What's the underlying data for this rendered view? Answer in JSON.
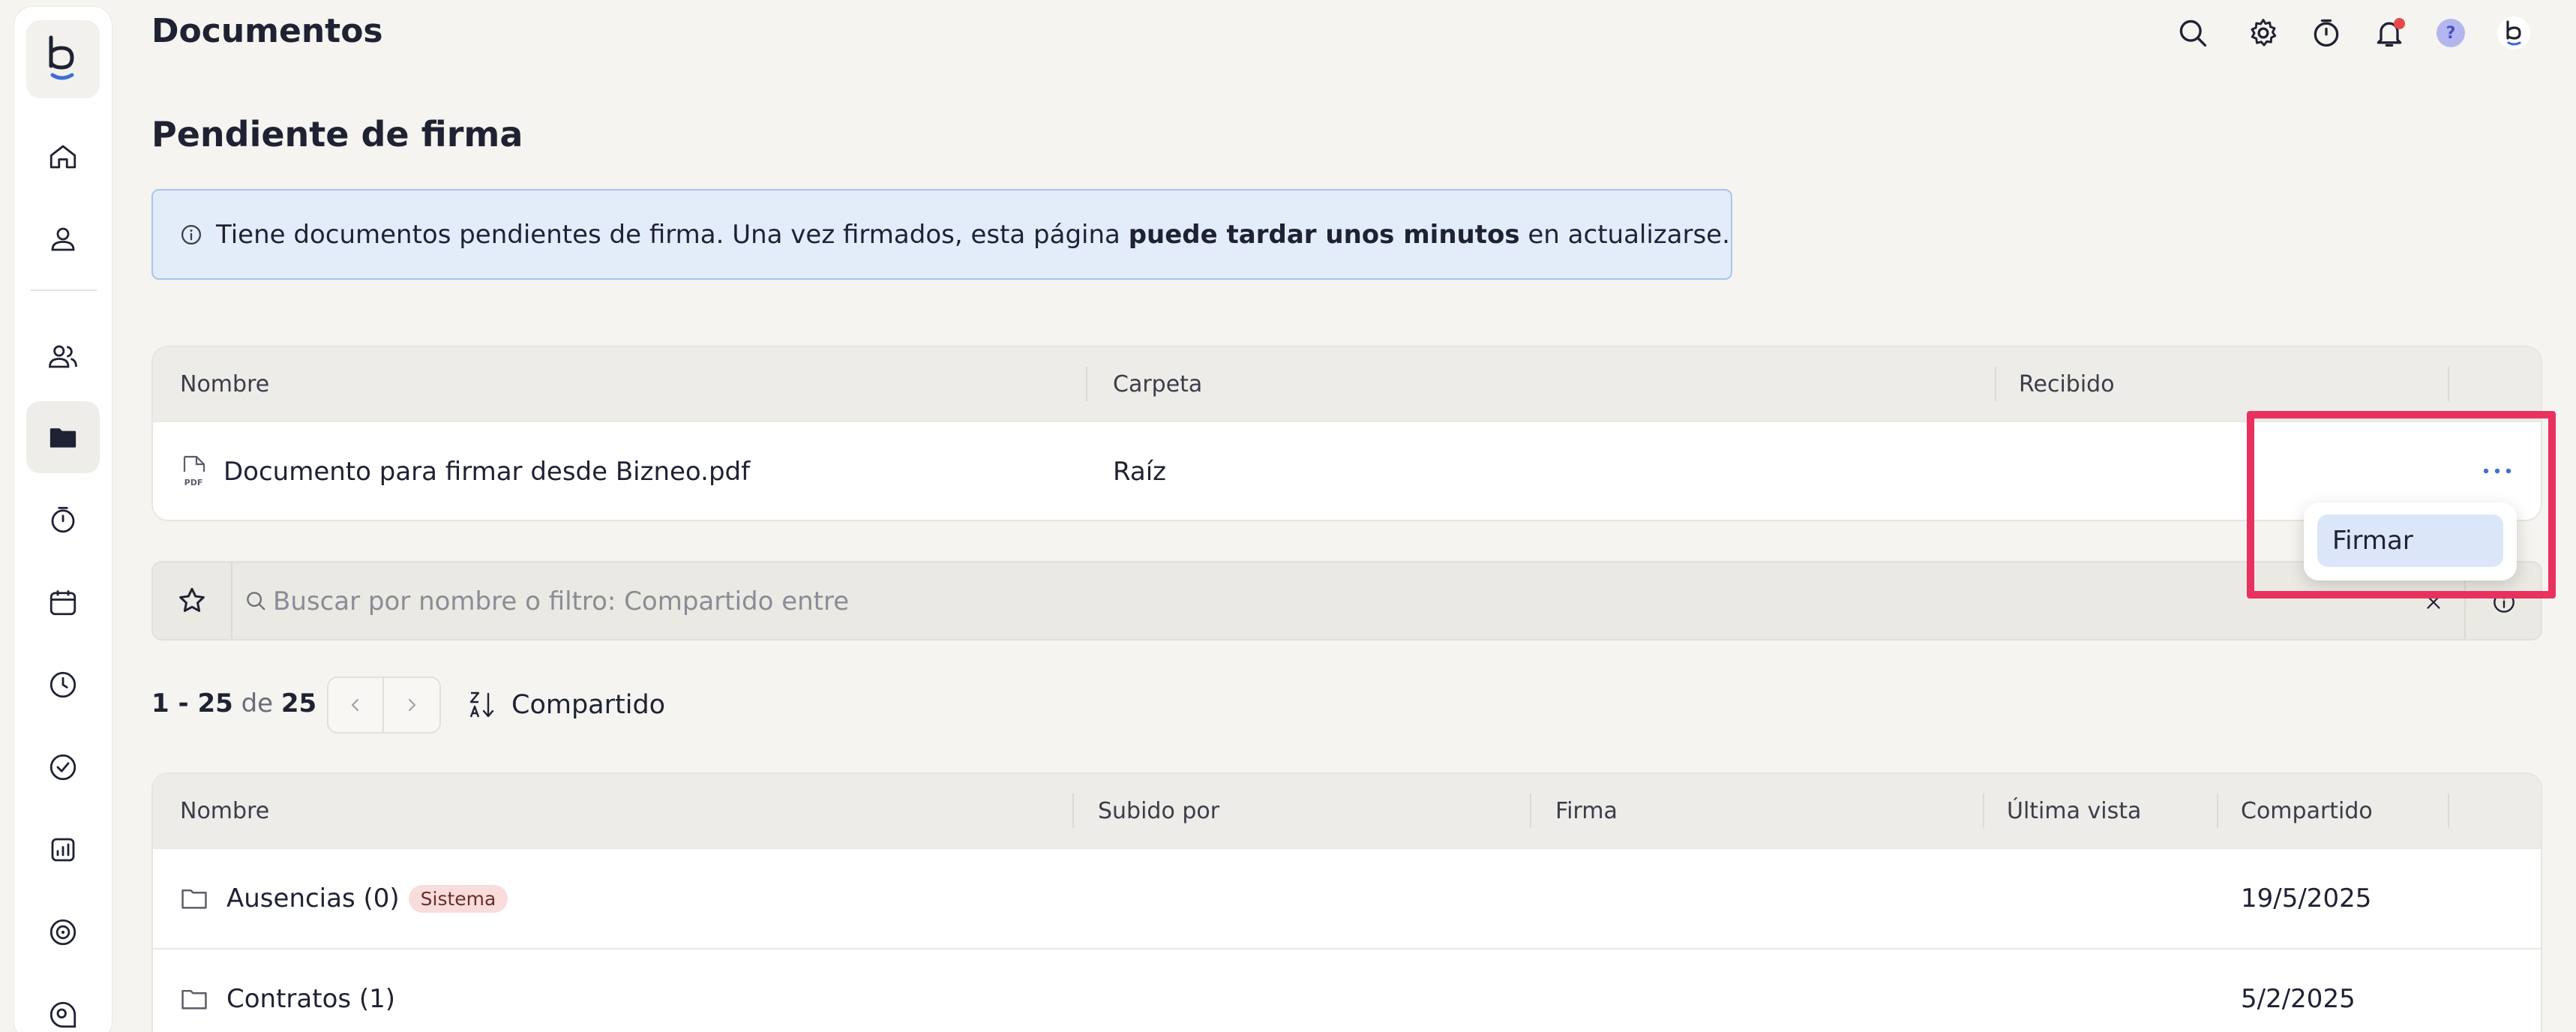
{
  "header": {
    "title": "Documentos",
    "icons": [
      "search-icon",
      "gear-icon",
      "timer-icon",
      "bell-icon",
      "help-icon",
      "avatar"
    ],
    "help_label": "?",
    "notification_dot_color": "#e5484d"
  },
  "sidebar": {
    "logo": "b",
    "items": [
      "home-icon",
      "user-icon",
      "users-icon",
      "folder-icon",
      "timer-icon",
      "calendar-icon",
      "clock-icon",
      "check-circle-icon",
      "chart-icon",
      "target-icon",
      "chat-search-icon"
    ],
    "active": "folder-icon"
  },
  "pending": {
    "title": "Pendiente de firma",
    "banner": {
      "text_before": "Tiene documentos pendientes de firma. Una vez firmados, esta página ",
      "text_bold": "puede tardar unos minutos",
      "text_after": " en actualizarse."
    },
    "columns": [
      "Nombre",
      "Carpeta",
      "Recibido"
    ],
    "rows": [
      {
        "name": "Documento para firmar desde Bizneo.pdf",
        "folder": "Raíz",
        "received": "",
        "file_type": "PDF"
      }
    ],
    "menu": {
      "items": [
        "Firmar"
      ]
    }
  },
  "search": {
    "placeholder": "Buscar por nombre o filtro: Compartido entre",
    "value": ""
  },
  "pagination": {
    "range": "1 - 25",
    "of": "de",
    "total": "25",
    "sort_label": "Compartido"
  },
  "documents": {
    "columns": [
      "Nombre",
      "Subido por",
      "Firma",
      "Última vista",
      "Compartido"
    ],
    "rows": [
      {
        "name": "Ausencias (0)",
        "badge": "Sistema",
        "uploaded_by": "",
        "signature": "",
        "last_view": "",
        "shared": "19/5/2025"
      },
      {
        "name": "Contratos (1)",
        "badge": "",
        "uploaded_by": "",
        "signature": "",
        "last_view": "",
        "shared": "5/2/2025"
      }
    ]
  },
  "colors": {
    "accent": "#3d6fd6",
    "highlight_border": "#e8315e",
    "banner_bg": "#e3edfa",
    "badge_bg": "#f9dcdc"
  }
}
